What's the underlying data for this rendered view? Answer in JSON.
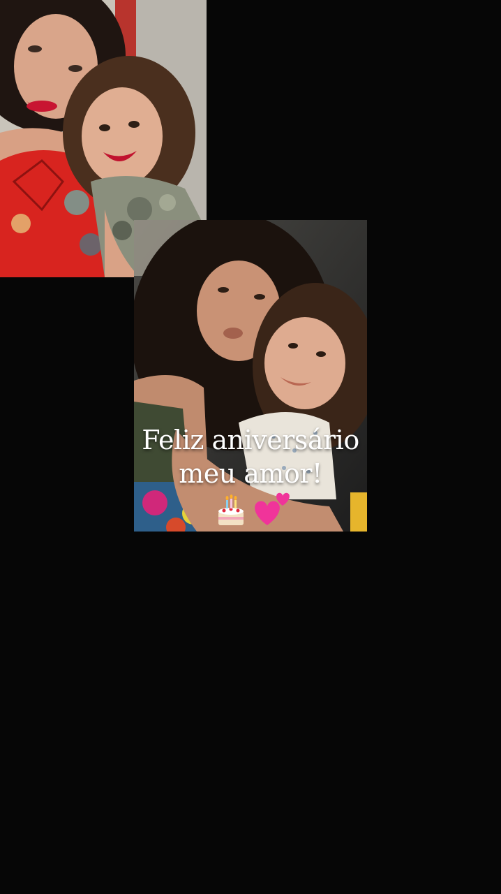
{
  "background_color": "#060606",
  "caption": {
    "line1": "Feliz aniversário",
    "line2": "meu amor!"
  },
  "stickers": {
    "cake": "birthday-cake-sticker",
    "hearts": "two-hearts-sticker"
  },
  "photos": [
    {
      "subject": "woman-in-red-dress-with-girl"
    },
    {
      "subject": "woman-hugging-girl"
    }
  ]
}
